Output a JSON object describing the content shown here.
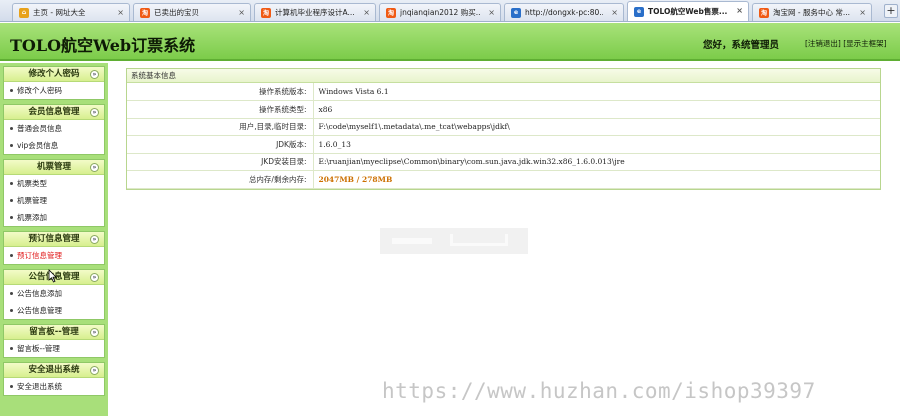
{
  "browser": {
    "tabs": [
      {
        "label": "主页 - 网址大全",
        "icon": "home-icon",
        "color": "#e8a21c"
      },
      {
        "label": "已卖出的宝贝",
        "icon": "taobao-icon",
        "color": "#f05a14"
      },
      {
        "label": "计算机毕业程序设计A...",
        "icon": "taobao-icon",
        "color": "#f05a14"
      },
      {
        "label": "jnqianqian2012 购买...",
        "icon": "taobao-icon",
        "color": "#f05a14"
      },
      {
        "label": "http://dongxk-pc:80...",
        "icon": "globe-icon",
        "color": "#2a6fc9"
      },
      {
        "label": "TOLO航空Web售票...",
        "icon": "globe-icon",
        "color": "#2a6fc9",
        "active": true
      },
      {
        "label": "淘宝网 - 服务中心 常...",
        "icon": "taobao-icon",
        "color": "#f05a14"
      }
    ]
  },
  "header": {
    "title": "TOLO航空Web订票系统",
    "welcome": "您好，系统管理员",
    "logout": "[注销退出]",
    "show_main": "[显示主框架]"
  },
  "sidebar": {
    "groups": [
      {
        "title": "修改个人密码",
        "items": [
          "修改个人密码"
        ]
      },
      {
        "title": "会员信息管理",
        "items": [
          "普通会员信息",
          "vip会员信息"
        ]
      },
      {
        "title": "机票管理",
        "items": [
          "机票类型",
          "机票管理",
          "机票添加"
        ]
      },
      {
        "title": "预订信息管理",
        "items": [
          "预订信息管理"
        ]
      },
      {
        "title": "公告信息管理",
        "items": [
          "公告信息添加",
          "公告信息管理"
        ]
      },
      {
        "title": "留言板--管理",
        "items": [
          "留言板--管理"
        ]
      },
      {
        "title": "安全退出系统",
        "items": [
          "安全退出系统"
        ]
      }
    ]
  },
  "main": {
    "panel_title": "系统基本信息",
    "rows": [
      {
        "label": "操作系统版本:",
        "value": "Windows Vista  6.1"
      },
      {
        "label": "操作系统类型:",
        "value": "x86"
      },
      {
        "label": "用户,目录,临时目录:",
        "value": "F:\\code\\myself1\\.metadata\\.me_tcat\\webapps\\jdkf\\"
      },
      {
        "label": "JDK版本:",
        "value": "1.6.0_13"
      },
      {
        "label": "JKD安装目录:",
        "value": "E:\\ruanjian\\myeclipse\\Common\\binary\\com.sun.java.jdk.win32.x86_1.6.0.013\\jre"
      },
      {
        "label": "总内存/剩余内存:",
        "value_total": "2047MB",
        "value_sep": " / ",
        "value_free": "278MB"
      }
    ]
  },
  "watermark": "https://www.huzhan.com/ishop39397",
  "colors": {
    "header_green": "#8fd45f",
    "sidebar_green": "#a8df7a",
    "highlight_red": "#e01818",
    "memory_orange": "#cc6f00"
  }
}
